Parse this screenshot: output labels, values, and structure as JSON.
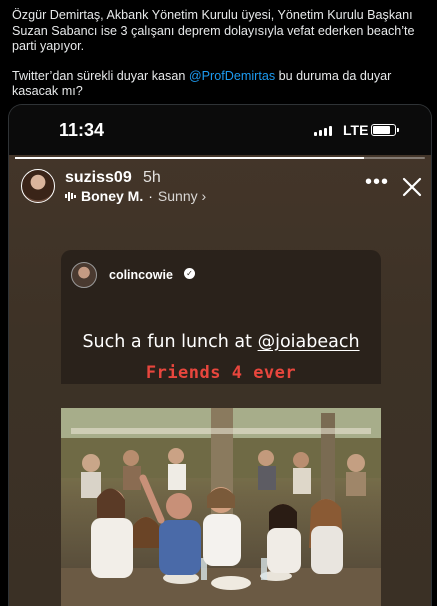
{
  "tweet": {
    "paragraph1": "Özgür Demirtaş, Akbank Yönetim Kurulu üyesi, Yönetim Kurulu Başkanı Suzan Sabancı ise 3 çalışanı deprem dolayısıyla vefat ederken beach’te parti yapıyor.",
    "paragraph2_before": "Twitter’dan sürekli duyar kasan ",
    "mention": "@ProfDemirtas",
    "paragraph2_after": " bu duruma da duyar kasacak mı?"
  },
  "phone": {
    "time": "11:34",
    "network": "LTE",
    "battery_level": 0.8,
    "signal_bars": 4
  },
  "story": {
    "progress": 0.85,
    "username": "suziss09",
    "time_ago": "5h",
    "music": {
      "artist": "Boney M.",
      "song": "Sunny ›"
    },
    "icons": {
      "more": "more-options-icon",
      "close": "close-icon",
      "music": "music-bars-icon"
    }
  },
  "reshared_post": {
    "username": "colincowie",
    "verified_icon": "verified-badge-icon",
    "caption_text": "Such a fun lunch at ",
    "caption_mention": "@joiabeach",
    "caption_secondary": "Friends 4 ever",
    "caption_secondary_color": "#e8463d"
  },
  "colors": {
    "mention": "#1d9bf0",
    "background": "#000000",
    "story_bg": "#3d3226"
  }
}
